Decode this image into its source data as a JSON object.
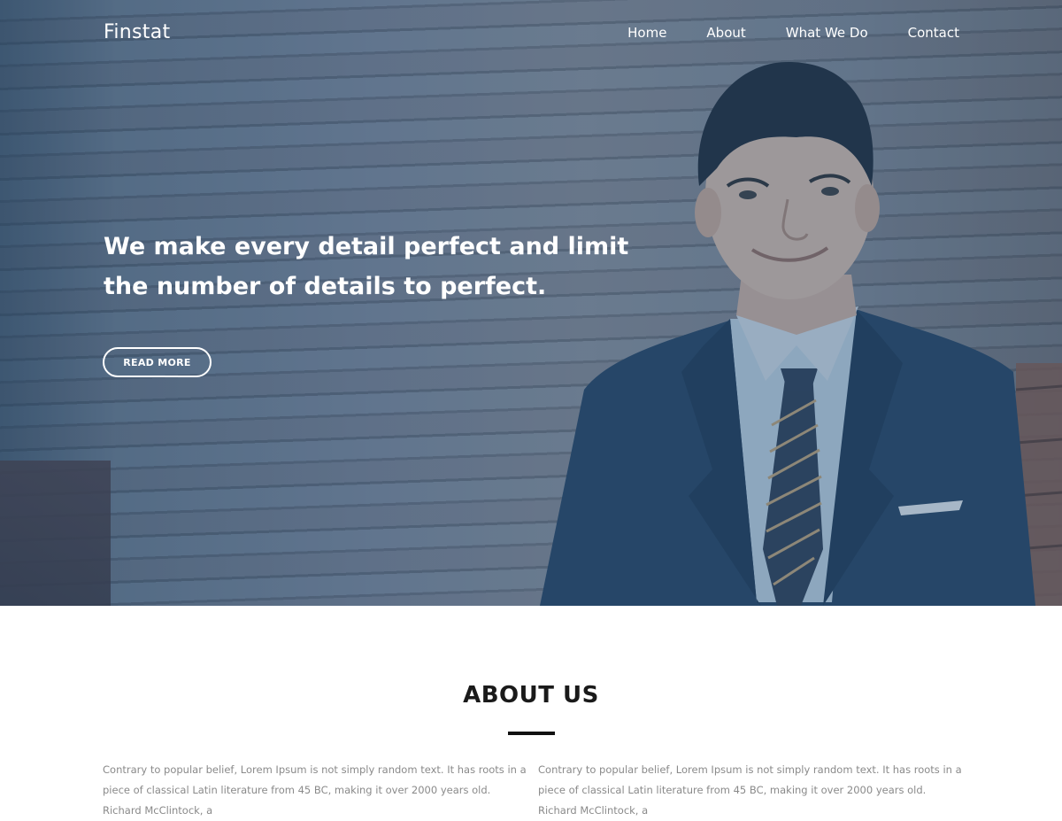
{
  "brand": {
    "name": "Finstat"
  },
  "nav": {
    "items": [
      {
        "label": "Home"
      },
      {
        "label": "About"
      },
      {
        "label": "What We Do"
      },
      {
        "label": "Contact"
      }
    ]
  },
  "hero": {
    "headline_line1": "We make every detail perfect and limit",
    "headline_line2": "the number of details to perfect.",
    "button_label": "READ MORE"
  },
  "about": {
    "title": "ABOUT US",
    "col_left": "Contrary to popular belief, Lorem Ipsum is not simply random text. It has roots in a piece of classical Latin literature from 45 BC, making it over 2000 years old. Richard McClintock, a",
    "col_right": "Contrary to popular belief, Lorem Ipsum is not simply random text. It has roots in a piece of classical Latin literature from 45 BC, making it over 2000 years old. Richard McClintock, a"
  },
  "colors": {
    "hero_tint": "#2c5278",
    "text_white": "#ffffff",
    "heading_dark": "#1a1a1a",
    "body_gray": "#8a8a8a"
  }
}
